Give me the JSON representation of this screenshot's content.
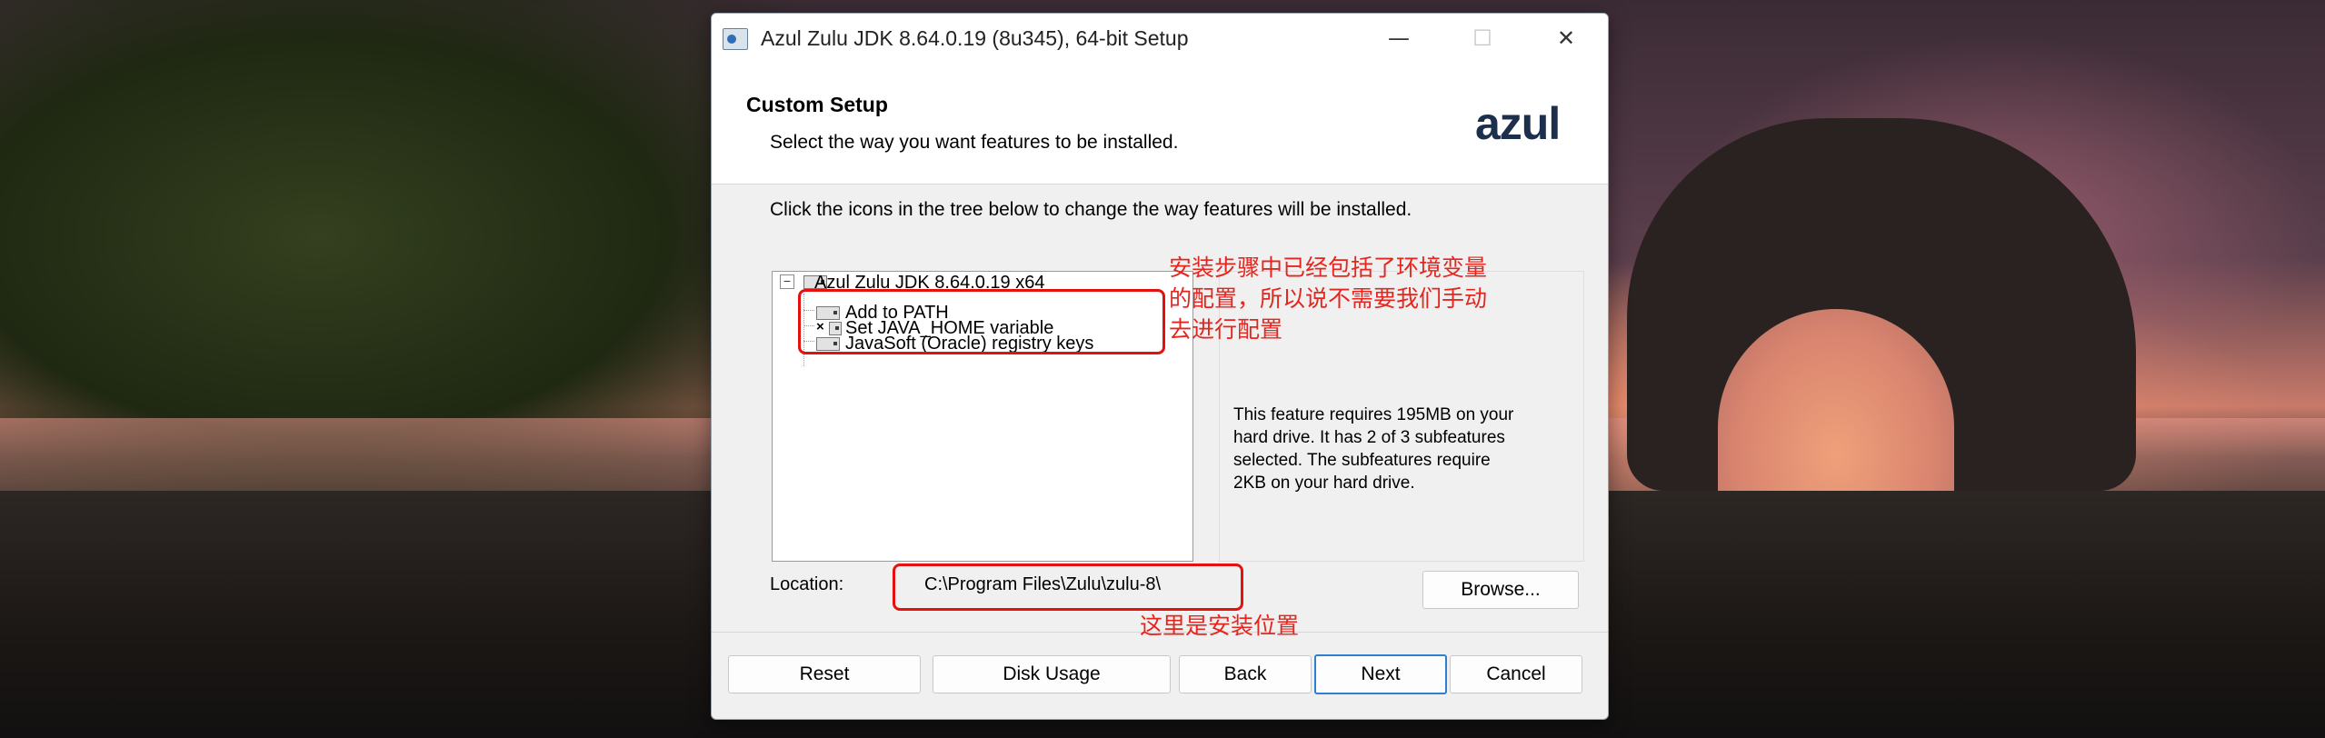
{
  "window": {
    "title": "Azul Zulu JDK 8.64.0.19 (8u345), 64-bit Setup",
    "minimize_glyph": "—",
    "maximize_glyph": "☐",
    "close_glyph": "✕"
  },
  "header": {
    "title": "Custom Setup",
    "subtitle": "Select the way you want features to be installed.",
    "logo": "azul"
  },
  "instruction": "Click the icons in the tree below to change the way features will be installed.",
  "tree": {
    "root": {
      "label": "Azul Zulu JDK 8.64.0.19 x64",
      "expander": "−"
    },
    "children": [
      {
        "label": "Add to PATH",
        "state": "install"
      },
      {
        "label": "Set JAVA_HOME variable",
        "state": "not-installed",
        "mark": "×"
      },
      {
        "label": "JavaSoft (Oracle) registry keys",
        "state": "install"
      }
    ]
  },
  "info": {
    "line1": "This feature requires 195MB on your",
    "line2": "hard drive. It has 2 of 3 subfeatures",
    "line3": "selected. The subfeatures require",
    "line4": "2KB on your hard drive."
  },
  "location": {
    "label": "Location:",
    "value": "C:\\Program Files\\Zulu\\zulu-8\\"
  },
  "buttons": {
    "browse": "Browse...",
    "reset": "Reset",
    "disk_usage": "Disk Usage",
    "back": "Back",
    "next": "Next",
    "cancel": "Cancel"
  },
  "annotations": {
    "env_line1": "安装步骤中已经包括了环境变量",
    "env_line2": "的配置，所以说不需要我们手动",
    "env_line3": "去进行配置",
    "location_note": "这里是安装位置"
  },
  "colors": {
    "annotation": "#e4261f",
    "primary_button_border": "#2f7fd0",
    "logo": "#1c2f4d"
  }
}
